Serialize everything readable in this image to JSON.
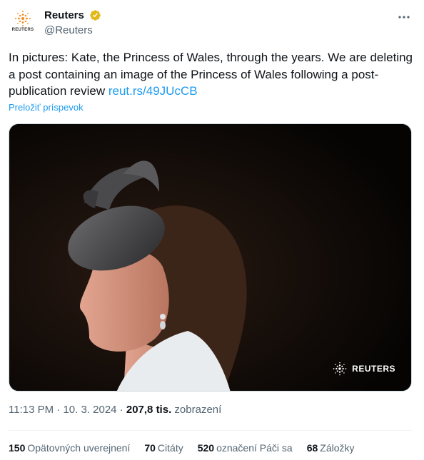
{
  "account": {
    "display_name": "Reuters",
    "handle": "@Reuters",
    "avatar_text": "REUTERS",
    "verified_color": "#e2b719"
  },
  "tweet": {
    "text": "In pictures: Kate, the Princess of Wales, through the years. We are deleting a post containing an image of the Princess of Wales following a post-publication review ",
    "link_text": "reut.rs/49JUcCB",
    "translate_label": "Preložiť príspevok"
  },
  "media": {
    "watermark_text": "REUTERS"
  },
  "meta": {
    "time": "11:13 PM",
    "separator": "·",
    "date": "10. 3. 2024",
    "views_count": "207,8 tis.",
    "views_label": "zobrazení"
  },
  "stats": [
    {
      "count": "150",
      "label": "Opätovných uverejnení"
    },
    {
      "count": "70",
      "label": "Citáty"
    },
    {
      "count": "520",
      "label": "označení Páči sa"
    },
    {
      "count": "68",
      "label": "Záložky"
    }
  ],
  "colors": {
    "link": "#1d9bf0",
    "text": "#0f1419",
    "secondary": "#536471"
  }
}
